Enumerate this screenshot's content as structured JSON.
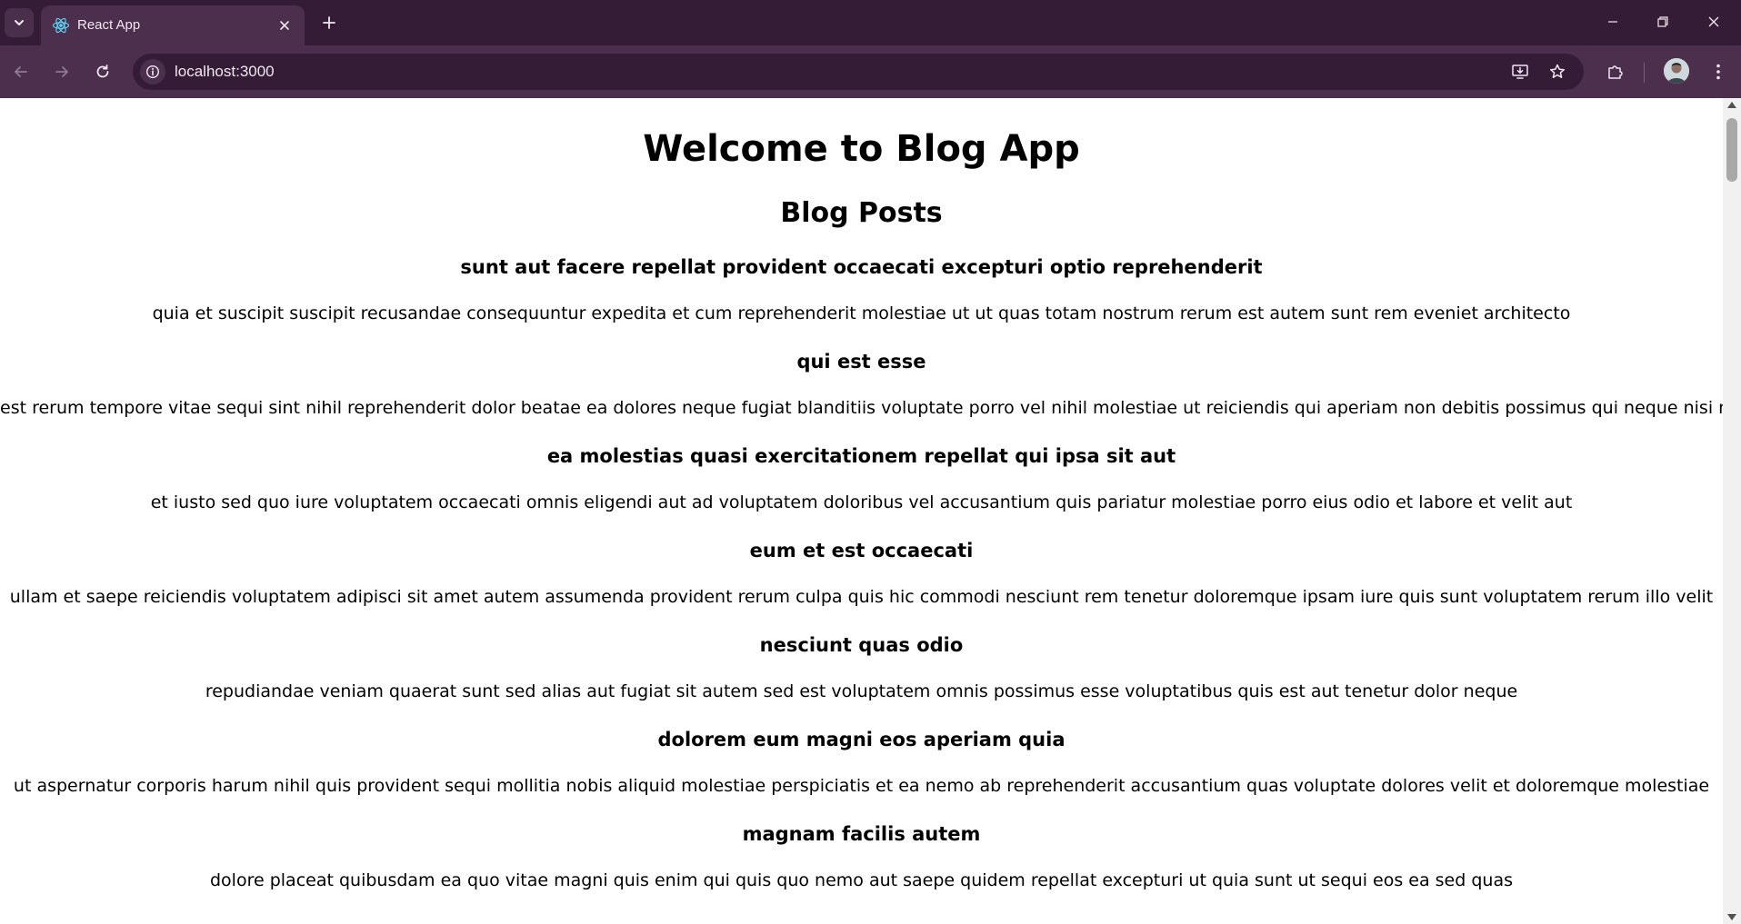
{
  "browser": {
    "tab_title": "React App",
    "url": "localhost:3000",
    "icons": {
      "tab_search": "chevron-down-icon",
      "favicon": "react-logo-icon",
      "tab_close": "close-icon",
      "new_tab": "plus-icon",
      "back": "arrow-left-icon",
      "forward": "arrow-right-icon",
      "reload": "reload-icon",
      "site_info": "info-icon",
      "install": "install-app-icon",
      "bookmark": "star-icon",
      "extensions": "puzzle-icon",
      "menu": "kebab-menu-icon"
    },
    "colors": {
      "titlebar": "#351c36",
      "toolbar": "#4b2f4d"
    }
  },
  "page": {
    "heading": "Welcome to Blog App",
    "subheading": "Blog Posts",
    "posts": [
      {
        "title": "sunt aut facere repellat provident occaecati excepturi optio reprehenderit",
        "body": "quia et suscipit suscipit recusandae consequuntur expedita et cum reprehenderit molestiae ut ut quas totam nostrum rerum est autem sunt rem eveniet architecto"
      },
      {
        "title": "qui est esse",
        "body": "est rerum tempore vitae sequi sint nihil reprehenderit dolor beatae ea dolores neque fugiat blanditiis voluptate porro vel nihil molestiae ut reiciendis qui aperiam non debitis possimus qui neque nisi nulla"
      },
      {
        "title": "ea molestias quasi exercitationem repellat qui ipsa sit aut",
        "body": "et iusto sed quo iure voluptatem occaecati omnis eligendi aut ad voluptatem doloribus vel accusantium quis pariatur molestiae porro eius odio et labore et velit aut"
      },
      {
        "title": "eum et est occaecati",
        "body": "ullam et saepe reiciendis voluptatem adipisci sit amet autem assumenda provident rerum culpa quis hic commodi nesciunt rem tenetur doloremque ipsam iure quis sunt voluptatem rerum illo velit"
      },
      {
        "title": "nesciunt quas odio",
        "body": "repudiandae veniam quaerat sunt sed alias aut fugiat sit autem sed est voluptatem omnis possimus esse voluptatibus quis est aut tenetur dolor neque"
      },
      {
        "title": "dolorem eum magni eos aperiam quia",
        "body": "ut aspernatur corporis harum nihil quis provident sequi mollitia nobis aliquid molestiae perspiciatis et ea nemo ab reprehenderit accusantium quas voluptate dolores velit et doloremque molestiae"
      },
      {
        "title": "magnam facilis autem",
        "body": "dolore placeat quibusdam ea quo vitae magni quis enim qui quis quo nemo aut saepe quidem repellat excepturi ut quia sunt ut sequi eos ea sed quas"
      }
    ]
  }
}
